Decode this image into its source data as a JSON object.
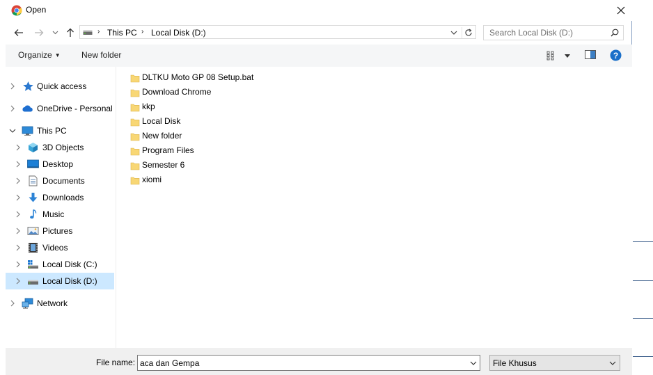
{
  "window": {
    "title": "Open"
  },
  "address": {
    "crumbs": [
      "This PC",
      "Local Disk (D:)"
    ],
    "search_placeholder": "Search Local Disk (D:)"
  },
  "toolbar": {
    "organize_label": "Organize",
    "new_folder_label": "New folder"
  },
  "navigation": [
    {
      "label": "Quick access",
      "icon": "star-icon",
      "expanded": false
    },
    {
      "label": "OneDrive - Personal",
      "icon": "cloud-icon",
      "expanded": false
    },
    {
      "label": "This PC",
      "icon": "computer-icon",
      "expanded": true
    },
    {
      "label": "3D Objects",
      "icon": "cube-icon",
      "expanded": false
    },
    {
      "label": "Desktop",
      "icon": "desktop-icon",
      "expanded": false
    },
    {
      "label": "Documents",
      "icon": "document-icon",
      "expanded": false
    },
    {
      "label": "Downloads",
      "icon": "download-icon",
      "expanded": false
    },
    {
      "label": "Music",
      "icon": "music-icon",
      "expanded": false
    },
    {
      "label": "Pictures",
      "icon": "picture-icon",
      "expanded": false
    },
    {
      "label": "Videos",
      "icon": "video-icon",
      "expanded": false
    },
    {
      "label": "Local Disk (C:)",
      "icon": "drive-icon",
      "expanded": false
    },
    {
      "label": "Local Disk (D:)",
      "icon": "drive-icon",
      "expanded": false,
      "selected": true
    },
    {
      "label": "Network",
      "icon": "network-icon",
      "expanded": false
    }
  ],
  "files": [
    "DLTKU  Moto GP 08 Setup.bat",
    "Download Chrome",
    "kkp",
    "Local Disk",
    "New folder",
    "Program Files",
    "Semester 6",
    "xiomi"
  ],
  "bottom": {
    "file_name_label": "File name:",
    "file_name_value": "aca dan Gempa",
    "filter_value": "File Khusus"
  },
  "colors": {
    "selection": "#cce8ff",
    "accent": "#0078d7",
    "folder": "#f8d775"
  }
}
